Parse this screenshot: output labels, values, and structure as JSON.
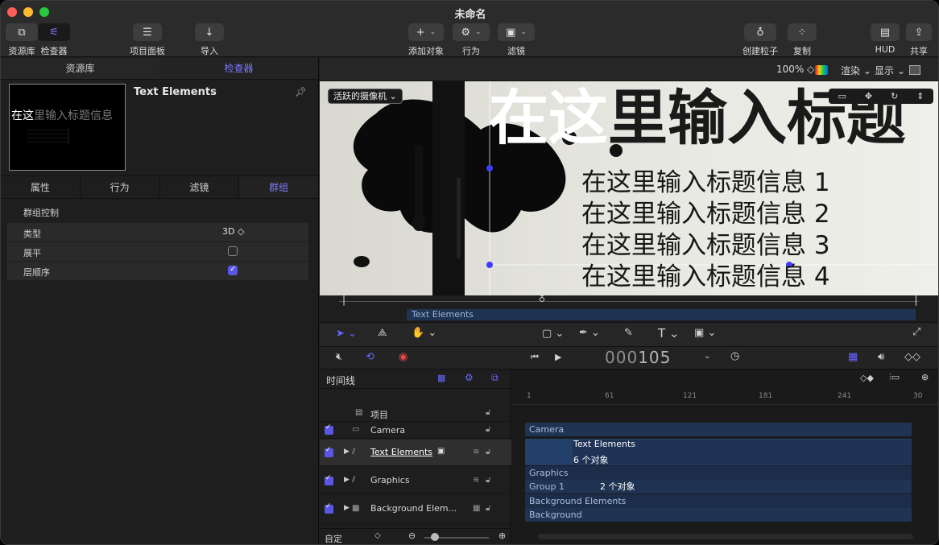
{
  "window": {
    "title": "未命名"
  },
  "toolbar": {
    "library_label": "资源库",
    "inspector_label": "检查器",
    "project_panel_label": "项目面板",
    "import_label": "导入",
    "add_object_label": "添加对象",
    "behaviors_label": "行为",
    "filters_label": "滤镜",
    "emitter_label": "创建粒子",
    "replicator_label": "复制",
    "hud_label": "HUD",
    "share_label": "共享"
  },
  "left_panel": {
    "tabs": [
      "资源库",
      "检查器"
    ],
    "active_tab": "检查器",
    "object_title": "Text Elements",
    "thumb_text_bright": "在这",
    "thumb_text_dim": "里输入标题信息",
    "sub_tabs": [
      "属性",
      "行为",
      "滤镜",
      "群组"
    ],
    "active_sub_tab": "群组",
    "group_controls_title": "群组控制",
    "rows": [
      {
        "label": "类型",
        "value": "3D ◇"
      },
      {
        "label": "展平",
        "value": ""
      },
      {
        "label": "层顺序",
        "value": ""
      }
    ]
  },
  "canvas_bar": {
    "zoom": "100% ◇",
    "render": "渲染 ⌄",
    "view": "显示 ⌄"
  },
  "canvas": {
    "camera_menu": "活跃的摄像机 ⌄",
    "title_white": "在这",
    "title_dark": "里输入标题",
    "subtitles": [
      "在这里输入标题信息 1",
      "在这里输入标题信息 2",
      "在这里输入标题信息 3",
      "在这里输入标题信息 4"
    ],
    "scrub_bar_label": "Text Elements"
  },
  "transport": {
    "timecode_dim": "000",
    "timecode_bright": "105"
  },
  "timeline": {
    "title": "时间线",
    "layers": [
      {
        "name": "项目"
      },
      {
        "name": "Camera"
      },
      {
        "name": "Text Elements"
      },
      {
        "name": "Graphics"
      },
      {
        "name": "Background Elem..."
      }
    ],
    "footer_label": "自定",
    "ruler_ticks": [
      "1",
      "61",
      "121",
      "181",
      "241",
      "30"
    ],
    "bars": {
      "camera": "Camera",
      "text_elements": "Text Elements",
      "text_count": "6 个对象",
      "graphics": "Graphics",
      "group1": "Group 1",
      "group_count": "2 个对象",
      "bg_elements": "Background Elements",
      "background": "Background"
    }
  }
}
